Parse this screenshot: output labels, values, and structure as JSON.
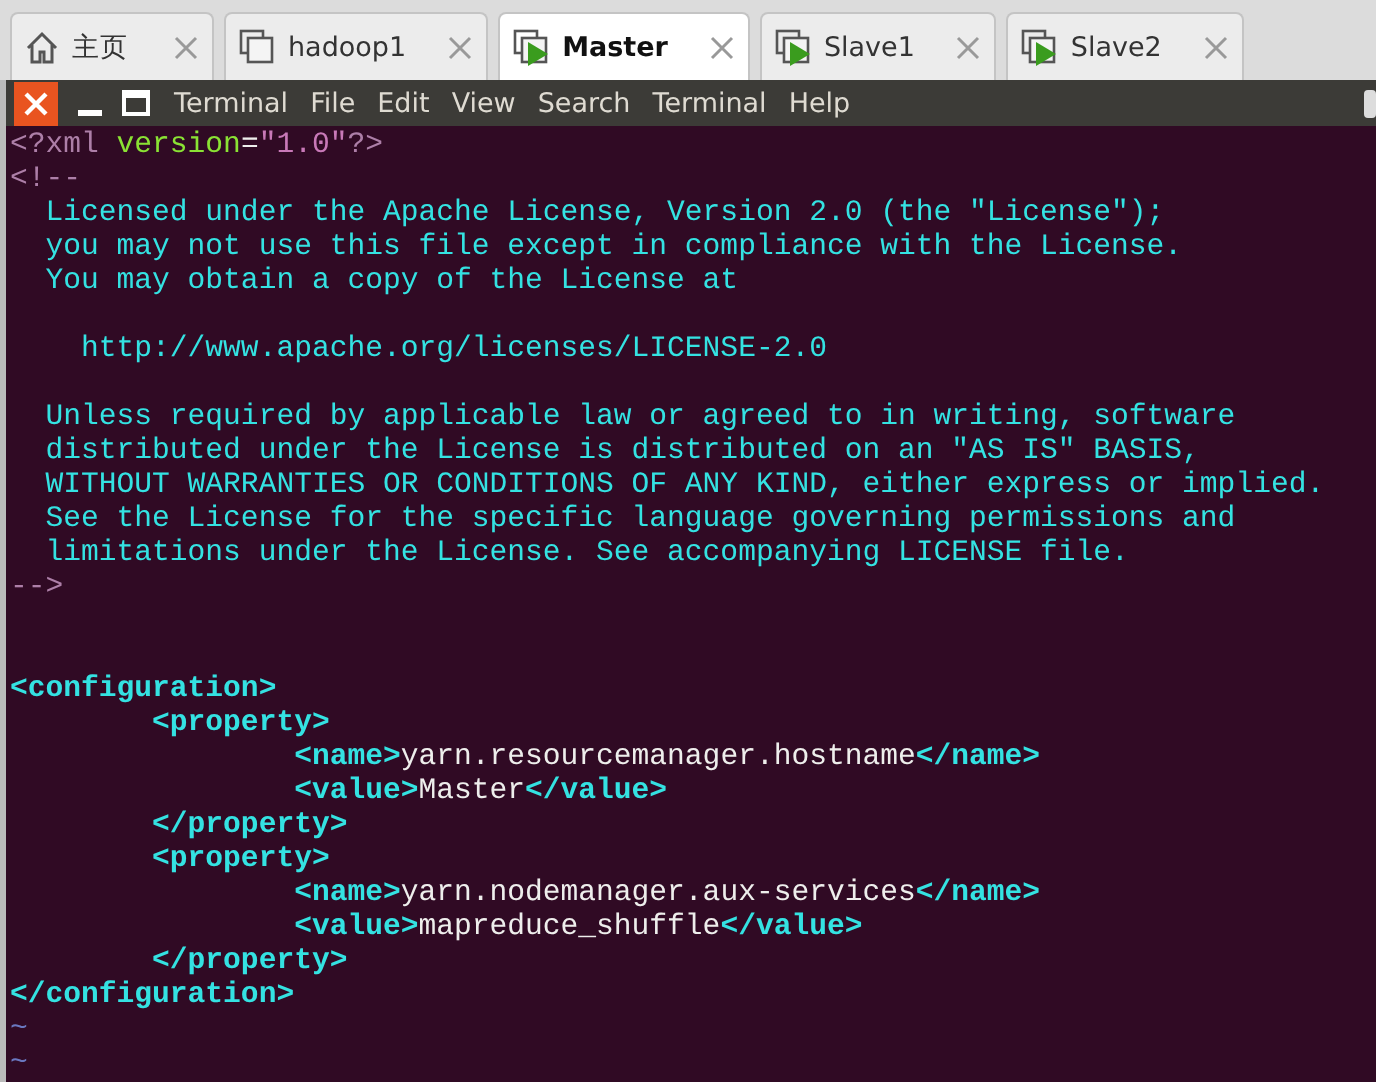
{
  "tabs": [
    {
      "label": "主页",
      "kind": "home",
      "selected": false
    },
    {
      "label": "hadoop1",
      "kind": "vm",
      "running": false,
      "selected": false
    },
    {
      "label": "Master",
      "kind": "vm",
      "running": true,
      "selected": true
    },
    {
      "label": "Slave1",
      "kind": "vm",
      "running": true,
      "selected": false
    },
    {
      "label": "Slave2",
      "kind": "vm",
      "running": true,
      "selected": false
    }
  ],
  "menu": [
    "Terminal",
    "File",
    "Edit",
    "View",
    "Search",
    "Terminal",
    "Help"
  ],
  "editor": {
    "lines": [
      {
        "kind": "code",
        "segments": [
          {
            "text": "<?xml ",
            "kind": "pi"
          },
          {
            "text": "version",
            "kind": "attr"
          },
          {
            "text": "=",
            "kind": "plain"
          },
          {
            "text": "\"1.0\"",
            "kind": "string"
          },
          {
            "text": "?>",
            "kind": "pi"
          }
        ]
      },
      {
        "kind": "code",
        "segments": [
          {
            "text": "<!--",
            "kind": "pi"
          }
        ]
      },
      {
        "kind": "code",
        "segments": [
          {
            "text": "  Licensed under the Apache License, Version 2.0 (the \"License\");",
            "kind": "comment"
          }
        ]
      },
      {
        "kind": "code",
        "segments": [
          {
            "text": "  you may not use this file except in compliance with the License.",
            "kind": "comment"
          }
        ]
      },
      {
        "kind": "code",
        "segments": [
          {
            "text": "  You may obtain a copy of the License at",
            "kind": "comment"
          }
        ]
      },
      {
        "kind": "blank"
      },
      {
        "kind": "code",
        "segments": [
          {
            "text": "    http://www.apache.org/licenses/LICENSE-2.0",
            "kind": "comment"
          }
        ]
      },
      {
        "kind": "blank"
      },
      {
        "kind": "code",
        "segments": [
          {
            "text": "  Unless required by applicable law or agreed to in writing, software",
            "kind": "comment"
          }
        ]
      },
      {
        "kind": "code",
        "segments": [
          {
            "text": "  distributed under the License is distributed on an \"AS IS\" BASIS,",
            "kind": "comment"
          }
        ]
      },
      {
        "kind": "code",
        "segments": [
          {
            "text": "  WITHOUT WARRANTIES OR CONDITIONS OF ANY KIND, either express or implied.",
            "kind": "comment"
          }
        ]
      },
      {
        "kind": "code",
        "segments": [
          {
            "text": "  See the License for the specific language governing permissions and",
            "kind": "comment"
          }
        ]
      },
      {
        "kind": "code",
        "segments": [
          {
            "text": "  limitations under the License. See accompanying LICENSE file.",
            "kind": "comment"
          }
        ]
      },
      {
        "kind": "code",
        "segments": [
          {
            "text": "-->",
            "kind": "pi"
          }
        ]
      },
      {
        "kind": "blank"
      },
      {
        "kind": "blank"
      },
      {
        "kind": "code",
        "segments": [
          {
            "text": "<configuration>",
            "kind": "tag"
          }
        ]
      },
      {
        "kind": "code",
        "segments": [
          {
            "text": "        <property>",
            "kind": "tag"
          }
        ]
      },
      {
        "kind": "code",
        "segments": [
          {
            "text": "                <name>",
            "kind": "tag"
          },
          {
            "text": "yarn.resourcemanager.hostname",
            "kind": "plain"
          },
          {
            "text": "</name>",
            "kind": "tag"
          }
        ]
      },
      {
        "kind": "code",
        "segments": [
          {
            "text": "                <value>",
            "kind": "tag"
          },
          {
            "text": "Master",
            "kind": "plain"
          },
          {
            "text": "</value>",
            "kind": "tag"
          }
        ]
      },
      {
        "kind": "code",
        "segments": [
          {
            "text": "        </property>",
            "kind": "tag"
          }
        ]
      },
      {
        "kind": "code",
        "segments": [
          {
            "text": "        <property>",
            "kind": "tag"
          }
        ]
      },
      {
        "kind": "code",
        "segments": [
          {
            "text": "                <name>",
            "kind": "tag"
          },
          {
            "text": "yarn.nodemanager.aux-services",
            "kind": "plain"
          },
          {
            "text": "</name>",
            "kind": "tag"
          }
        ]
      },
      {
        "kind": "code",
        "segments": [
          {
            "text": "                <value>",
            "kind": "tag"
          },
          {
            "text": "mapreduce_shuffle",
            "kind": "plain"
          },
          {
            "text": "</value>",
            "kind": "tag"
          }
        ]
      },
      {
        "kind": "code",
        "segments": [
          {
            "text": "        </property>",
            "kind": "tag"
          }
        ]
      },
      {
        "kind": "code",
        "segments": [
          {
            "text": "</configuration>",
            "kind": "tag"
          }
        ]
      },
      {
        "kind": "code",
        "segments": [
          {
            "text": "~",
            "kind": "tilde"
          }
        ]
      },
      {
        "kind": "code",
        "segments": [
          {
            "text": "~",
            "kind": "tilde"
          }
        ]
      }
    ]
  }
}
